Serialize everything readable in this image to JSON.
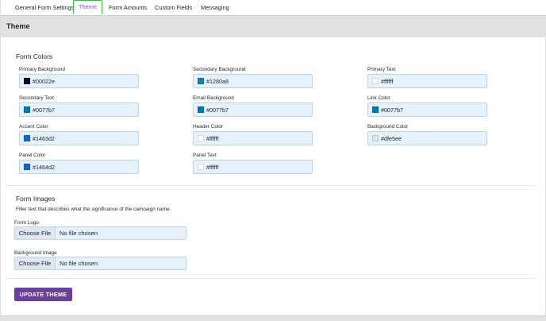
{
  "tabs": [
    {
      "label": "General Form Settings",
      "active": false
    },
    {
      "label": "Theme",
      "active": true
    },
    {
      "label": "Form Amounts",
      "active": false
    },
    {
      "label": "Custom Fields",
      "active": false
    },
    {
      "label": "Messaging",
      "active": false
    }
  ],
  "section_title": "Theme",
  "form_colors": {
    "title": "Form Colors",
    "fields": [
      {
        "label": "Primary Background",
        "value": "#00022e",
        "swatch": "#00022e"
      },
      {
        "label": "Secondary Background",
        "value": "#1280a8",
        "swatch": "#1280a8"
      },
      {
        "label": "Primary Text",
        "value": "#ffffff",
        "swatch": "#ffffff"
      },
      {
        "label": "Secondary Text",
        "value": "#0077b7",
        "swatch": "#0077b7"
      },
      {
        "label": "Email Background",
        "value": "#0077b7",
        "swatch": "#0077b7"
      },
      {
        "label": "Link Color",
        "value": "#0077b7",
        "swatch": "#0077b7"
      },
      {
        "label": "Accent Color",
        "value": "#1463d2",
        "swatch": "#1463d2"
      },
      {
        "label": "Header Color",
        "value": "#ffffff",
        "swatch": "#ffffff"
      },
      {
        "label": "Background Color",
        "value": "#dfe5ee",
        "swatch": "#dfe5ee"
      },
      {
        "label": "Panel Color",
        "value": "#1464d2",
        "swatch": "#1464d2"
      },
      {
        "label": "Panel Text",
        "value": "#ffffff",
        "swatch": "#ffffff"
      }
    ]
  },
  "form_images": {
    "title": "Form Images",
    "description": "Filler text that describes what the significance of the camoaign name.",
    "fields": [
      {
        "label": "Form Logo",
        "button": "Choose File",
        "status": "No file chosen"
      },
      {
        "label": "Background Image",
        "button": "Choose File",
        "status": "No file chosen"
      }
    ]
  },
  "update_button": "UPDATE THEME",
  "colors": {
    "accent_purple": "#6b3fa0",
    "active_tab_border": "#3db64a",
    "field_bg": "#e5f1fb"
  }
}
